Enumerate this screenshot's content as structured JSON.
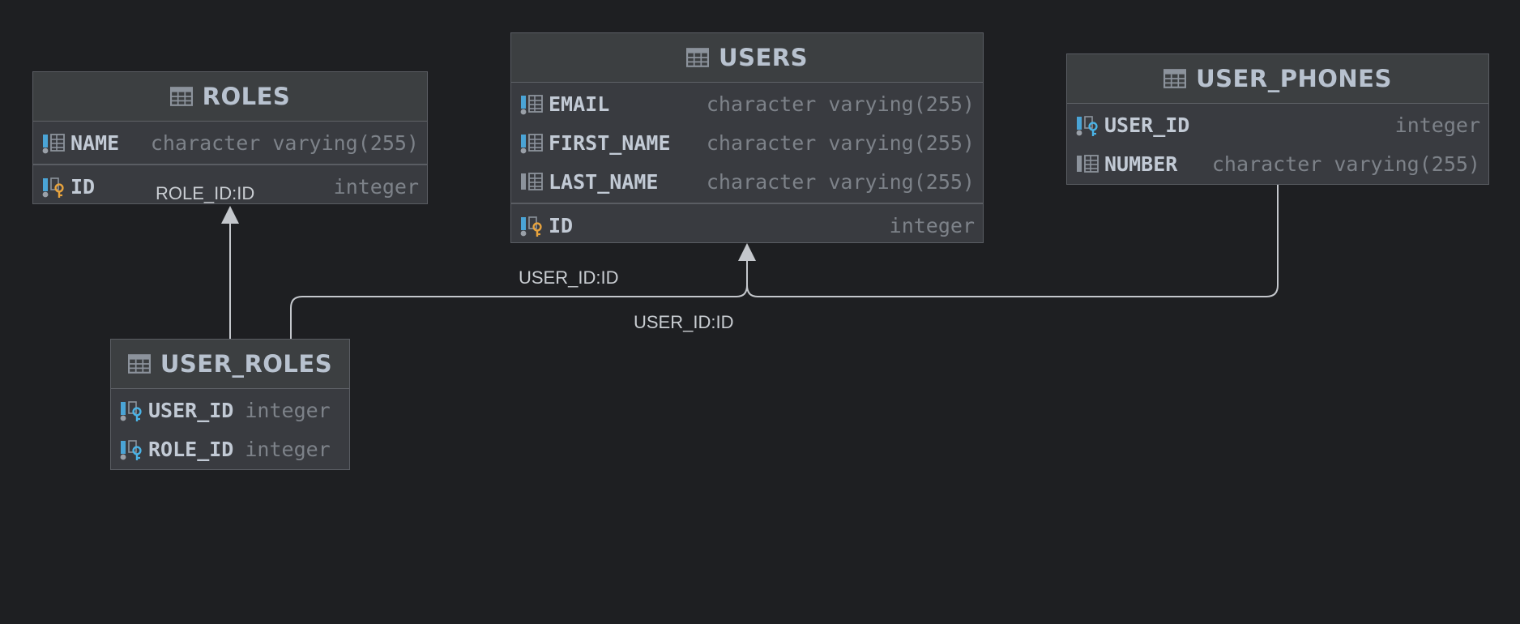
{
  "tables": {
    "roles": {
      "name": "ROLES",
      "columns": [
        {
          "name": "NAME",
          "type": "character varying(255)"
        },
        {
          "name": "ID",
          "type": "integer"
        }
      ]
    },
    "users": {
      "name": "USERS",
      "columns": [
        {
          "name": "EMAIL",
          "type": "character varying(255)"
        },
        {
          "name": "FIRST_NAME",
          "type": "character varying(255)"
        },
        {
          "name": "LAST_NAME",
          "type": "character varying(255)"
        },
        {
          "name": "ID",
          "type": "integer"
        }
      ]
    },
    "user_phones": {
      "name": "USER_PHONES",
      "columns": [
        {
          "name": "USER_ID",
          "type": "integer"
        },
        {
          "name": "NUMBER",
          "type": "character varying(255)"
        }
      ]
    },
    "user_roles": {
      "name": "USER_ROLES",
      "columns": [
        {
          "name": "USER_ID",
          "type": "integer"
        },
        {
          "name": "ROLE_ID",
          "type": "integer"
        }
      ]
    }
  },
  "relationships": [
    {
      "label": "ROLE_ID:ID",
      "from": "USER_ROLES",
      "to": "ROLES"
    },
    {
      "label": "USER_ID:ID",
      "from": "USER_ROLES",
      "to": "USERS"
    },
    {
      "label": "USER_ID:ID",
      "from": "USER_PHONES",
      "to": "USERS"
    }
  ],
  "colors": {
    "background": "#1e1f22",
    "table_body": "#393b40",
    "table_header": "#3c3f41",
    "border": "#5a5d63",
    "name_text": "#c2cad5",
    "type_text": "#7d8289",
    "edge": "#c4c7cc",
    "primary_key": "#e8a33d",
    "foreign_key": "#4ab3e6"
  },
  "icons": {
    "table": "table-icon",
    "column": "column-icon",
    "column_indexed": "indexed-column-icon",
    "primary_key": "primary-key-column-icon",
    "foreign_key": "foreign-key-column-icon"
  }
}
